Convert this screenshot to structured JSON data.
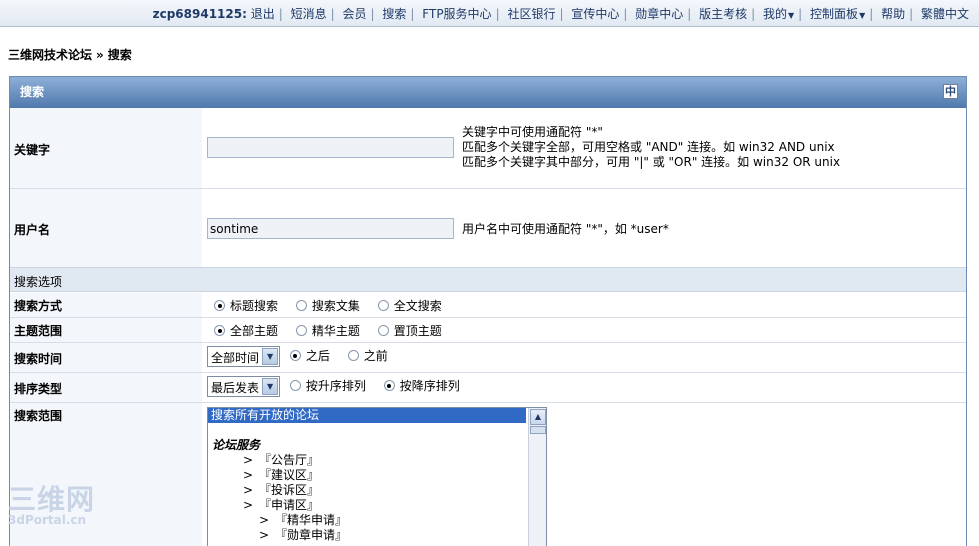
{
  "topnav": {
    "username": "zcp68941125:",
    "links": [
      "退出",
      "短消息",
      "会员",
      "搜索",
      "FTP服务中心",
      "社区银行",
      "宣传中心",
      "勋章中心",
      "版主考核",
      "我的",
      "控制面板",
      "帮助",
      "繁體中文"
    ]
  },
  "breadcrumb": {
    "forum": "三维网技术论坛",
    "sep": "»",
    "page": "搜索"
  },
  "panel": {
    "title": "搜索",
    "collapse_glyph": "中"
  },
  "keyword": {
    "label": "关键字",
    "value": "",
    "hints": [
      "关键字中可使用通配符 \"*\"",
      "匹配多个关键字全部，可用空格或 \"AND\" 连接。如 win32 AND unix",
      "匹配多个关键字其中部分，可用 \"|\" 或 \"OR\" 连接。如 win32 OR unix"
    ]
  },
  "username": {
    "label": "用户名",
    "value": "sontime",
    "hint": "用户名中可使用通配符 \"*\"，如 *user*"
  },
  "options_header": "搜索选项",
  "search_mode": {
    "label": "搜索方式",
    "options": [
      "标题搜索",
      "搜索文集",
      "全文搜索"
    ],
    "selected": 0
  },
  "thread_scope": {
    "label": "主题范围",
    "options": [
      "全部主题",
      "精华主题",
      "置顶主题"
    ],
    "selected": 0
  },
  "search_time": {
    "label": "搜索时间",
    "select_value": "全部时间",
    "options": [
      "之后",
      "之前"
    ],
    "selected": 0
  },
  "sort_type": {
    "label": "排序类型",
    "select_value": "最后发表",
    "options": [
      "按升序排列",
      "按降序排列"
    ],
    "selected": 1
  },
  "search_range": {
    "label": "搜索范围",
    "selected_item": "搜索所有开放的论坛",
    "category": "论坛服务",
    "items": [
      ">　『公告厅』",
      ">　『建议区』",
      ">　『投诉区』",
      ">　『申请区』"
    ],
    "subitems": [
      ">　『精华申请』",
      ">　『勋章申请』"
    ]
  },
  "watermark": {
    "big": "三维网",
    "small": "3dPortal.cn"
  },
  "icons": {
    "dropdown": "chevron-down-icon",
    "scroll_up": "scroll-up-arrow-icon",
    "collapse": "collapse-icon"
  }
}
